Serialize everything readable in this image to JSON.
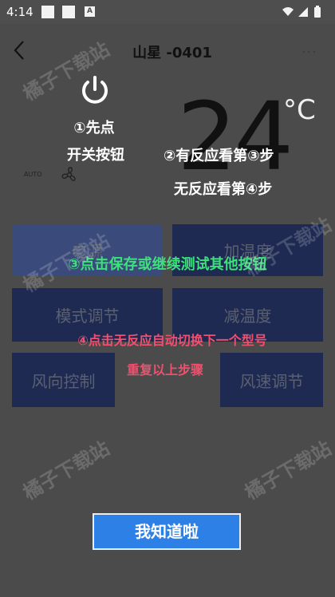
{
  "status_bar": {
    "time": "4:14",
    "a_badge": "A"
  },
  "nav": {
    "title": "山星 -0401",
    "more": "···"
  },
  "remote": {
    "temperature": "24",
    "unit": "°C",
    "auto_label": "AUTO",
    "keys": {
      "power": "电源",
      "warm": "加温度",
      "mode": "模式调节",
      "cool": "减温度",
      "direction": "风向控制",
      "speed": "风速调节"
    }
  },
  "guide": {
    "step1": "①先点",
    "switch": "开关按钮",
    "step2": "②有反应看第③步",
    "step2b": "无反应看第④步",
    "step3": "③点击保存或继续测试其他按钮",
    "step4": "④点击无反应自动切换下一个型号",
    "repeat": "重复以上步骤",
    "ok_button": "我知道啦"
  },
  "watermark": "橘子下载站",
  "colors": {
    "overlay_bg": "#4b4b4b",
    "key_bg": "#1e2a52",
    "accent_green": "#3de07c",
    "accent_red": "#f0506e",
    "button_blue": "#2d80e6"
  }
}
